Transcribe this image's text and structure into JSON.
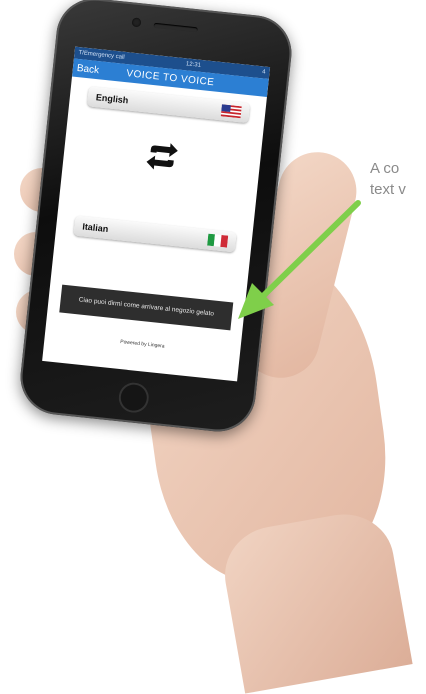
{
  "annotation": {
    "line1": "A co",
    "line2": "text v",
    "arrow_color": "#7fcf4a"
  },
  "status_bar": {
    "carrier": "T/Emergency call",
    "time": "12:31",
    "battery": "4"
  },
  "nav": {
    "back_label": "Back",
    "title": "VOICE TO VOICE"
  },
  "source_language": {
    "label": "English",
    "flag_icon": "us-flag-icon"
  },
  "swap": {
    "icon": "swap-arrows-icon"
  },
  "target_language": {
    "label": "Italian",
    "flag_icon": "italy-flag-icon"
  },
  "translation_output": "Ciao puoi dirmi come arrivare al negozio gelato",
  "footer": {
    "powered_by": "Powered by Lingera"
  },
  "colors": {
    "nav_blue": "#2c7fd3",
    "status_blue": "#1d4f8d",
    "output_bg": "#2e2e2e"
  }
}
